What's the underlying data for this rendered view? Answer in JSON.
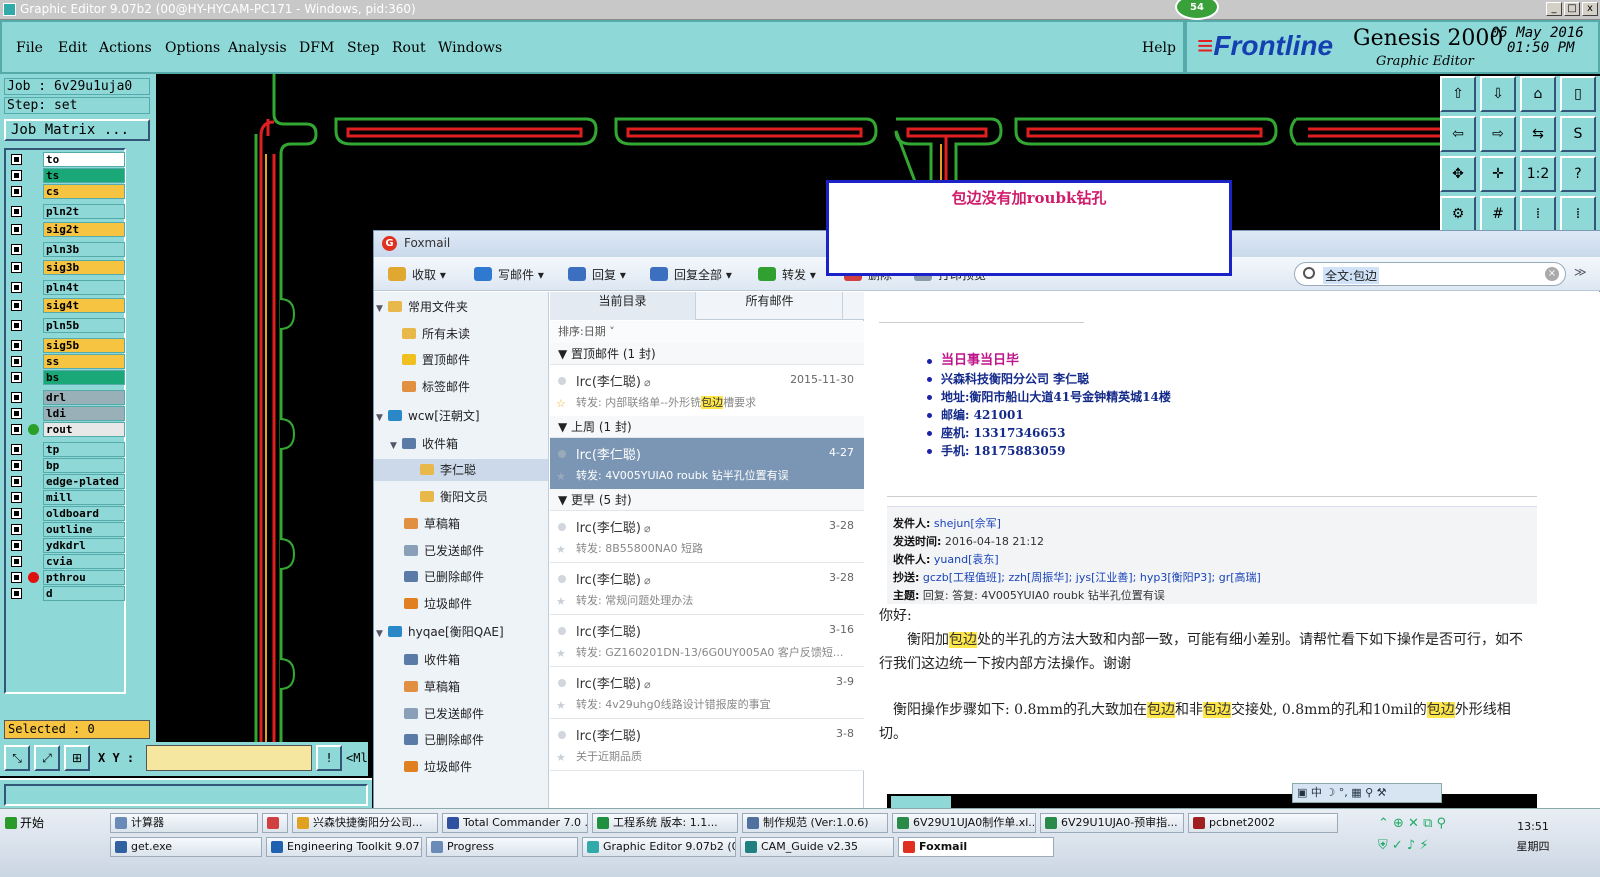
{
  "window": {
    "title": "Graphic Editor 9.07b2 (00@HY-HYCAM-PC171 - Windows, pid:360)",
    "badge": "54",
    "min": "_",
    "max": "□",
    "close": "x"
  },
  "menu": {
    "file": "File",
    "edit": "Edit",
    "actions": "Actions",
    "options": "Options",
    "analysis": "Analysis",
    "dfm": "DFM",
    "step": "Step",
    "rout": "Rout",
    "windows": "Windows",
    "help": "Help"
  },
  "brand": {
    "logo": "Frontline",
    "product": "Genesis 2000",
    "subtitle": "Graphic Editor",
    "date": "05 May 2016",
    "time": "01:50 PM"
  },
  "job": {
    "job": "Job : 6v29u1uja0",
    "step": "Step: set",
    "matrix": "Job Matrix ..."
  },
  "layers": [
    {
      "name": "to",
      "color": "#ffffff"
    },
    {
      "name": "ts",
      "color": "#1aa878"
    },
    {
      "name": "cs",
      "color": "#f6c440"
    },
    {
      "name": "pln2t",
      "color": "#8fd8d8"
    },
    {
      "name": "sig2t",
      "color": "#f6c440"
    },
    {
      "name": "pln3b",
      "color": "#8fd8d8"
    },
    {
      "name": "sig3b",
      "color": "#f6c440"
    },
    {
      "name": "pln4t",
      "color": "#8fd8d8"
    },
    {
      "name": "sig4t",
      "color": "#f6c440"
    },
    {
      "name": "pln5b",
      "color": "#8fd8d8"
    },
    {
      "name": "sig5b",
      "color": "#f6c440"
    },
    {
      "name": "ss",
      "color": "#f6c440"
    },
    {
      "name": "bs",
      "color": "#1aa878"
    },
    {
      "name": "drl",
      "color": "#9ab0b8"
    },
    {
      "name": "ldi",
      "color": "#9ab0b8"
    },
    {
      "name": "rout",
      "color": "#e8e8e8"
    },
    {
      "name": "tp",
      "color": "#8fd8d8"
    },
    {
      "name": "bp",
      "color": "#8fd8d8"
    },
    {
      "name": "edge-plated",
      "color": "#8fd8d8"
    },
    {
      "name": "mill",
      "color": "#8fd8d8"
    },
    {
      "name": "oldboard",
      "color": "#8fd8d8"
    },
    {
      "name": "outline",
      "color": "#8fd8d8"
    },
    {
      "name": "ydkdrl",
      "color": "#8fd8d8"
    },
    {
      "name": "cvia",
      "color": "#8fd8d8"
    },
    {
      "name": "pthrou",
      "color": "#8fd8d8"
    },
    {
      "name": "d",
      "color": "#8fd8d8"
    }
  ],
  "selected": "Selected : 0",
  "xy": {
    "label": "X Y :",
    "value": "",
    "extra": "<Ml"
  },
  "note": "包边没有加roubk钻孔",
  "foxmail": {
    "title": "Foxmail",
    "toolbar": {
      "receive": "收取",
      "write": "写邮件",
      "reply": "回复",
      "reply_all": "回复全部",
      "forward": "转发",
      "delete": "删除",
      "print": "打印预览"
    },
    "search": "全文:包边",
    "tree": {
      "common": "常用文件夹",
      "unread": "所有未读",
      "starred": "置顶邮件",
      "tagged": "标签邮件",
      "acct1": "wcw[汪朝文]",
      "inbox1": "收件箱",
      "sub1": "李仁聪",
      "sub2": "衡阳文员",
      "drafts1": "草稿箱",
      "sent1": "已发送邮件",
      "deleted1": "已删除邮件",
      "junk1": "垃圾邮件",
      "acct2": "hyqae[衡阳QAE]",
      "inbox2": "收件箱",
      "drafts2": "草稿箱",
      "sent2": "已发送邮件",
      "deleted2": "已删除邮件",
      "junk2": "垃圾邮件"
    },
    "list": {
      "tab_current": "当前目录",
      "tab_all": "所有邮件",
      "sort": "排序:日期 ˅",
      "grp_top": "置顶邮件 (1 封)",
      "grp_week": "上周 (1 封)",
      "grp_older": "更早 (5 封)"
    },
    "mails": [
      {
        "from": "lrc(李仁聪)",
        "date": "2015-11-30",
        "subject_pre": "转发: 内部联络单--外形铣",
        "subject_hl": "包边",
        "subject_post": "槽要求"
      },
      {
        "from": "lrc(李仁聪)",
        "date": "4-27",
        "subject_pre": "转发: 4V005YUIA0    roubk 钻半孔位置有误",
        "subject_hl": "",
        "subject_post": ""
      },
      {
        "from": "lrc(李仁聪)",
        "date": "3-28",
        "subject_pre": "转发: 8B55800NA0 短路",
        "subject_hl": "",
        "subject_post": ""
      },
      {
        "from": "lrc(李仁聪)",
        "date": "3-28",
        "subject_pre": "转发: 常规问题处理办法",
        "subject_hl": "",
        "subject_post": ""
      },
      {
        "from": "lrc(李仁聪)",
        "date": "3-16",
        "subject_pre": "转发: GZ160201DN-13/6G0UY005A0 客户反馈短...",
        "subject_hl": "",
        "subject_post": ""
      },
      {
        "from": "lrc(李仁聪)",
        "date": "3-9",
        "subject_pre": "转发: 4v29uhg0线路设计错报废的事宜",
        "subject_hl": "",
        "subject_post": ""
      },
      {
        "from": "lrc(李仁聪)",
        "date": "3-8",
        "subject_pre": "关于近期品质",
        "subject_hl": "",
        "subject_post": ""
      }
    ],
    "preview": {
      "sig": [
        "当日事当日毕",
        "兴森科技衡阳分公司   李仁聪",
        "地址:衡阳市船山大道41号金钟精英城14楼",
        "邮编: 421001",
        "座机: 13317346653",
        "手机: 18175883059"
      ],
      "from_label": "发件人:",
      "from": "shejun[佘军]",
      "time_label": "发送时间:",
      "time": "2016-04-18 21:12",
      "to_label": "收件人:",
      "to": "yuand[袁东]",
      "cc_label": "抄送:",
      "cc": "gczb[工程值班]; zzh[周振华]; jys[江业善]; hyp3[衡阳P3]; gr[高瑞]",
      "subj_label": "主题:",
      "subj": "回复: 答复: 4V005YUIA0 roubk 钻半孔位置有误",
      "greet": "你好:",
      "p1a": "衡阳加",
      "p1b": "包边",
      "p1c": "处的半孔的方法大致和内部一致，可能有细小差别。请帮忙看下如下操作是否可行，如不行我们这边统一下按内部方法操作。谢谢",
      "p2a": "衡阳操作步骤如下: 0.8mm的孔大致加在",
      "p2b": "包边",
      "p2c": "和非",
      "p2d": "包边",
      "p2e": "交接处, 0.8mm的孔和10mil的",
      "p2f": "包边",
      "p2g": "外形线相切。"
    }
  },
  "taskbar": {
    "start": "开始",
    "row1": [
      "计算器",
      "",
      "兴森快捷衡阳分公司...",
      "Total Commander 7.0 ...",
      "工程系统  版本: 1.1...",
      "制作规范 (Ver:1.0.6)",
      "6V29U1UJA0制作单.xl...",
      "6V29U1UJA0-预审指...",
      "pcbnet2002"
    ],
    "row2": [
      "get.exe",
      "Engineering Toolkit 9.07...",
      "Progress",
      "Graphic Editor 9.07b2 (0...",
      "CAM_Guide v2.35",
      "Foxmail"
    ],
    "time": "13:51",
    "day": "星期四"
  }
}
